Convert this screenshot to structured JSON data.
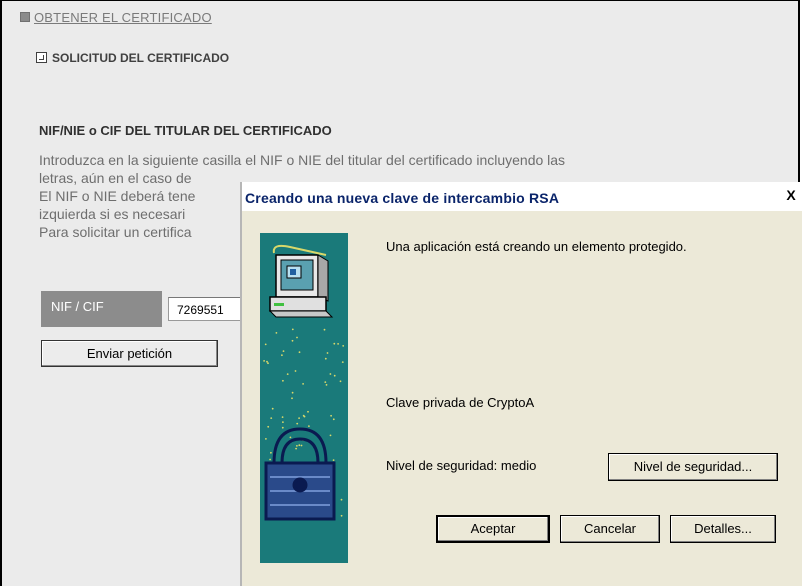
{
  "page": {
    "section_link": "OBTENER EL CERTIFICADO",
    "sub_link": "SOLICITUD DEL CERTIFICADO",
    "heading": "NIF/NIE o CIF DEL TITULAR DEL CERTIFICADO",
    "intro_lines": [
      "Introduzca en la siguiente casilla el NIF o NIE del titular del certificado incluyendo las",
      "letras, aún en el caso de",
      "El NIF o NIE deberá tene",
      "izquierda si es necesari",
      "Para solicitar un certifica"
    ],
    "nif_label": "NIF / CIF",
    "nif_value": "7269551",
    "send_button": "Enviar petición"
  },
  "dialog": {
    "title": "Creando una nueva clave de intercambio RSA",
    "close": "X",
    "message": "Una aplicación está creando un elemento protegido.",
    "key_name": "Clave privada de CryptoA",
    "security_level": "Nivel de seguridad: medio",
    "buttons": {
      "security": "Nivel de seguridad...",
      "accept": "Aceptar",
      "cancel": "Cancelar",
      "details": "Detalles..."
    }
  },
  "colors": {
    "art_background": "#1a7a7a",
    "art_dots": "#d8d86a",
    "title_text": "#0a246a",
    "page_background": "#ebebeb"
  },
  "icons": [
    "square-bullet-icon",
    "arrow-box-icon",
    "computer-icon",
    "padlock-icon",
    "close-icon"
  ]
}
